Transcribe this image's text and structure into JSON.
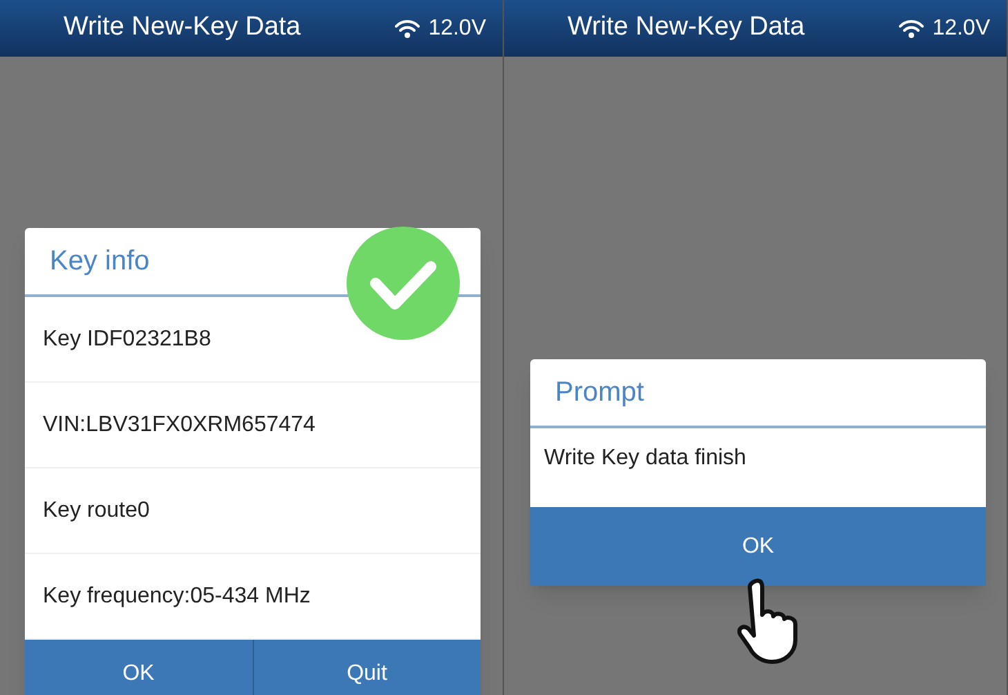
{
  "screens": [
    {
      "header": {
        "title": "Write New-Key Data",
        "voltage": "12.0V"
      },
      "dialog": {
        "kind": "info",
        "title": "Key info",
        "rows": [
          "Key IDF02321B8",
          "VIN:LBV31FX0XRM657474",
          "Key route0",
          "Key frequency:05-434 MHz"
        ],
        "buttons": [
          "OK",
          "Quit"
        ],
        "success_badge": true,
        "pointer": false
      }
    },
    {
      "header": {
        "title": "Write New-Key Data",
        "voltage": "12.0V"
      },
      "dialog": {
        "kind": "prompt",
        "title": "Prompt",
        "rows": [
          "Write Key data finish"
        ],
        "buttons": [
          "OK"
        ],
        "success_badge": false,
        "pointer": true
      }
    }
  ]
}
